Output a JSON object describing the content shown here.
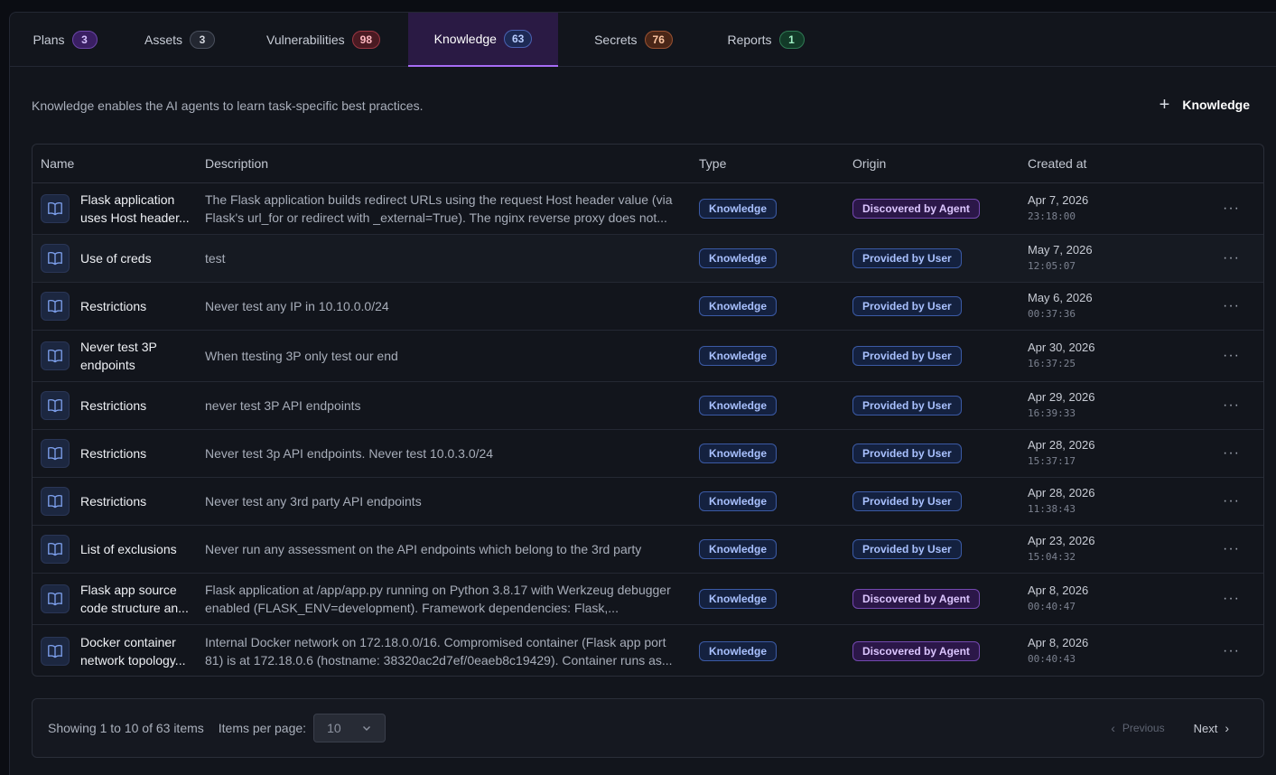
{
  "tabs": [
    {
      "label": "Plans",
      "count": "3",
      "color": "purple",
      "active": false
    },
    {
      "label": "Assets",
      "count": "3",
      "color": "gray",
      "active": false
    },
    {
      "label": "Vulnerabilities",
      "count": "98",
      "color": "red",
      "active": false
    },
    {
      "label": "Knowledge",
      "count": "63",
      "color": "blue",
      "active": true
    },
    {
      "label": "Secrets",
      "count": "76",
      "color": "orange",
      "active": false
    },
    {
      "label": "Reports",
      "count": "1",
      "color": "green",
      "active": false
    }
  ],
  "intro": "Knowledge enables the AI agents to learn task-specific best practices.",
  "add_button": {
    "icon": "plus-icon",
    "label": "Knowledge"
  },
  "table": {
    "headers": {
      "name": "Name",
      "description": "Description",
      "type": "Type",
      "origin": "Origin",
      "created": "Created at"
    },
    "rows": [
      {
        "name": "Flask application uses Host header...",
        "description": "The Flask application builds redirect URLs using the request Host header value (via Flask's url_for or redirect with _external=True). The nginx reverse proxy does not...",
        "type": "Knowledge",
        "origin": "Discovered by Agent",
        "origin_kind": "agent",
        "date": "Apr 7, 2026",
        "time": "23:18:00"
      },
      {
        "name": "Use of creds",
        "description": "test",
        "type": "Knowledge",
        "origin": "Provided by User",
        "origin_kind": "user",
        "date": "May 7, 2026",
        "time": "12:05:07"
      },
      {
        "name": "Restrictions",
        "description": "Never test any IP in 10.10.0.0/24",
        "type": "Knowledge",
        "origin": "Provided by User",
        "origin_kind": "user",
        "date": "May 6, 2026",
        "time": "00:37:36"
      },
      {
        "name": "Never test 3P endpoints",
        "description": "When ttesting 3P only test our end",
        "type": "Knowledge",
        "origin": "Provided by User",
        "origin_kind": "user",
        "date": "Apr 30, 2026",
        "time": "16:37:25"
      },
      {
        "name": "Restrictions",
        "description": "never test 3P API endpoints",
        "type": "Knowledge",
        "origin": "Provided by User",
        "origin_kind": "user",
        "date": "Apr 29, 2026",
        "time": "16:39:33"
      },
      {
        "name": "Restrictions",
        "description": "Never test 3p API endpoints. Never test 10.0.3.0/24",
        "type": "Knowledge",
        "origin": "Provided by User",
        "origin_kind": "user",
        "date": "Apr 28, 2026",
        "time": "15:37:17"
      },
      {
        "name": "Restrictions",
        "description": "Never test any 3rd party API endpoints",
        "type": "Knowledge",
        "origin": "Provided by User",
        "origin_kind": "user",
        "date": "Apr 28, 2026",
        "time": "11:38:43"
      },
      {
        "name": "List of exclusions",
        "description": "Never run any assessment on the API endpoints which belong to the 3rd party",
        "type": "Knowledge",
        "origin": "Provided by User",
        "origin_kind": "user",
        "date": "Apr 23, 2026",
        "time": "15:04:32"
      },
      {
        "name": "Flask app source code structure an...",
        "description": "Flask application at /app/app.py running on Python 3.8.17 with Werkzeug debugger enabled (FLASK_ENV=development). Framework dependencies: Flask,...",
        "type": "Knowledge",
        "origin": "Discovered by Agent",
        "origin_kind": "agent",
        "date": "Apr 8, 2026",
        "time": "00:40:47"
      },
      {
        "name": "Docker container network topology...",
        "description": "Internal Docker network on 172.18.0.0/16. Compromised container (Flask app port 81) is at 172.18.0.6 (hostname: 38320ac2d7ef/0eaeb8c19429). Container runs as...",
        "type": "Knowledge",
        "origin": "Discovered by Agent",
        "origin_kind": "agent",
        "date": "Apr 8, 2026",
        "time": "00:40:43"
      }
    ]
  },
  "pagination": {
    "showing": "Showing 1 to 10 of 63 items",
    "items_per_page_label": "Items per page:",
    "items_per_page_value": "10",
    "previous": "Previous",
    "next": "Next"
  }
}
